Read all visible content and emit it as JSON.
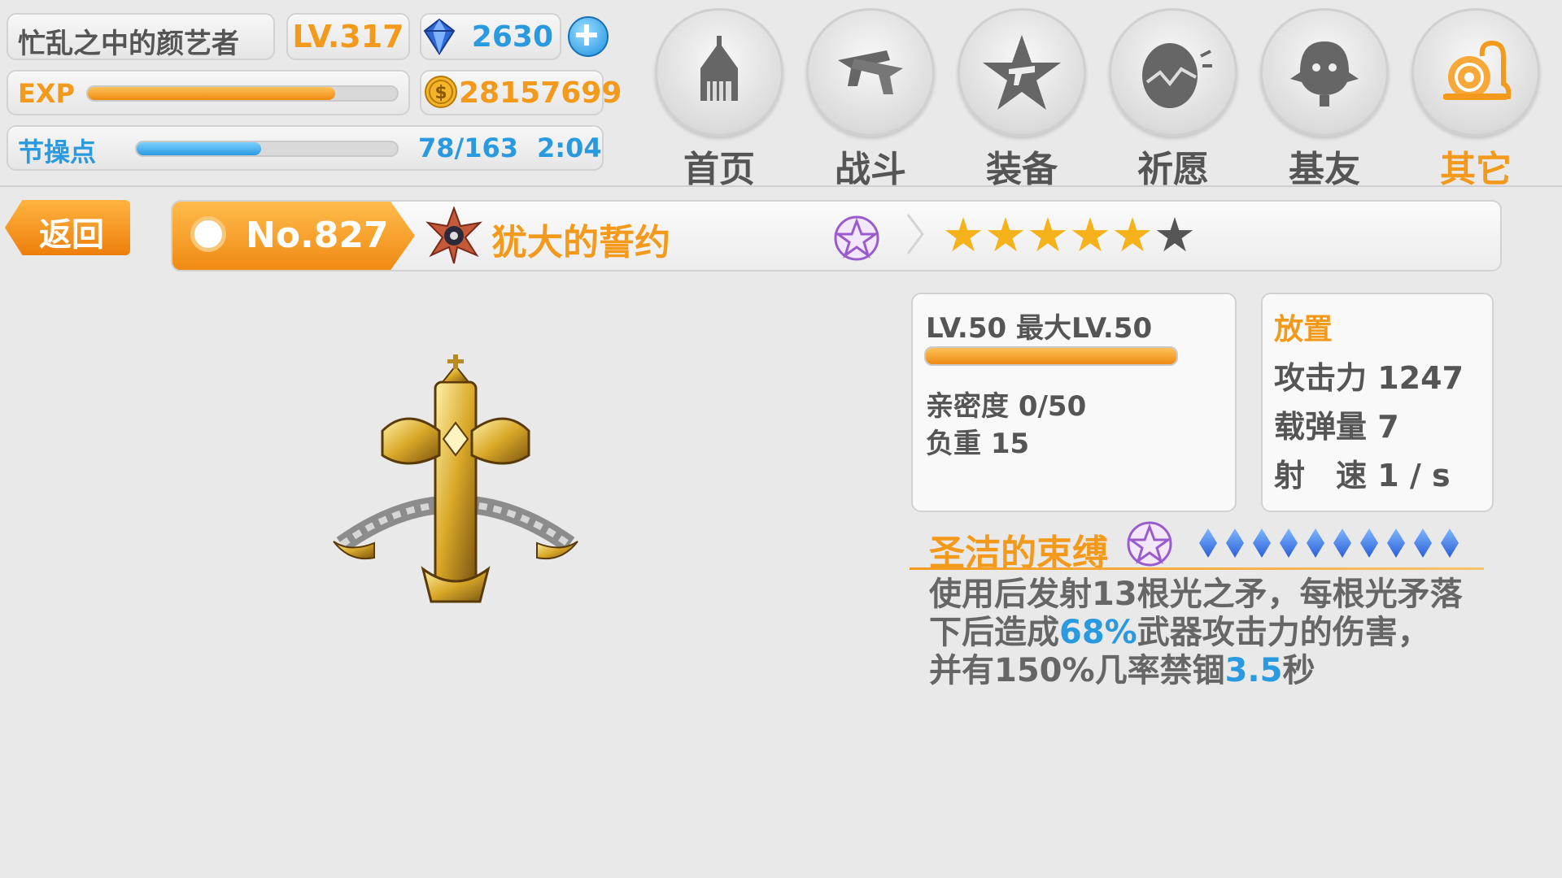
{
  "player": {
    "name": "忙乱之中的颜艺者",
    "level": "LV.317",
    "gems": "2630",
    "coins": "28157699",
    "exp_label": "EXP",
    "exp_progress": 0.8,
    "stamina_label": "节操点",
    "stamina_value": "78/163",
    "stamina_progress": 0.479,
    "timer": "2:04"
  },
  "nav": {
    "items": [
      {
        "label": "首页",
        "icon": "church-icon"
      },
      {
        "label": "战斗",
        "icon": "guns-icon"
      },
      {
        "label": "装备",
        "icon": "star-gun-icon"
      },
      {
        "label": "祈愿",
        "icon": "egg-icon"
      },
      {
        "label": "基友",
        "icon": "friend-icon"
      },
      {
        "label": "其它",
        "icon": "snail-icon"
      }
    ],
    "active_index": 5
  },
  "back_label": "返回",
  "weapon": {
    "number": "No.827",
    "name": "犹大的誓约",
    "stars_filled": 5,
    "stars_total": 6,
    "level_text": "LV.50 最大LV.50",
    "level_progress": 1.0,
    "affinity": "亲密度 0/50",
    "weight": "负重 15",
    "type_label": "放置",
    "attack": "攻击力 1247",
    "ammo": "载弹量 7",
    "speed": "射　速 1 / s"
  },
  "skill": {
    "name": "圣洁的束缚",
    "level_gems": 10,
    "desc_part1": "使用后发射13根光之矛，每根光矛落",
    "desc_part2a": "下后造成",
    "desc_highlight1": "68%",
    "desc_part2b": "武器攻击力的伤害，",
    "desc_part3a": "并有150%几率禁锢",
    "desc_highlight2": "3.5",
    "desc_part3b": "秒"
  },
  "colors": {
    "accent": "#f39a1c",
    "highlight": "#2a9ae0"
  }
}
